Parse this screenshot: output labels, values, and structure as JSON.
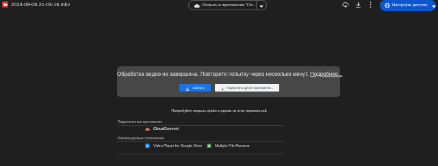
{
  "file": {
    "name": "2024-09-06 21-03-16.mkv"
  },
  "toolbar": {
    "open_with_label": "Открыть в приложении \"Clo...",
    "share_label": "Настройки доступа"
  },
  "error": {
    "message": "Обработка видео не завершена. Повторите попытку через несколько минут.",
    "more_link": "Подробнее...",
    "download_label": "Скачать",
    "connect_label": "Подключить другие приложения..."
  },
  "suggestions": {
    "heading": "Попробуйте открыть файл в одном из этих приложений",
    "connected_label": "Подключенные приложения",
    "connected": [
      {
        "name": "CloudConvert"
      }
    ],
    "recommended_label": "Рекомендуемые приложения",
    "recommended": [
      {
        "name": "Video Player for Google Drive"
      },
      {
        "name": "Multiple File Rename"
      }
    ]
  },
  "colors": {
    "background": "#1f1f1f",
    "card": "#474747",
    "primary": "#1a73e8",
    "share": "#0b57d0",
    "file_icon": "#d93025"
  },
  "icons": [
    "video-file-icon",
    "cloud-icon",
    "chevron-down-icon",
    "add-shortcut-icon",
    "download-icon",
    "more-vert-icon",
    "globe-icon",
    "plus-icon",
    "cloudconvert-icon",
    "video-player-icon",
    "multiple-file-rename-icon"
  ]
}
